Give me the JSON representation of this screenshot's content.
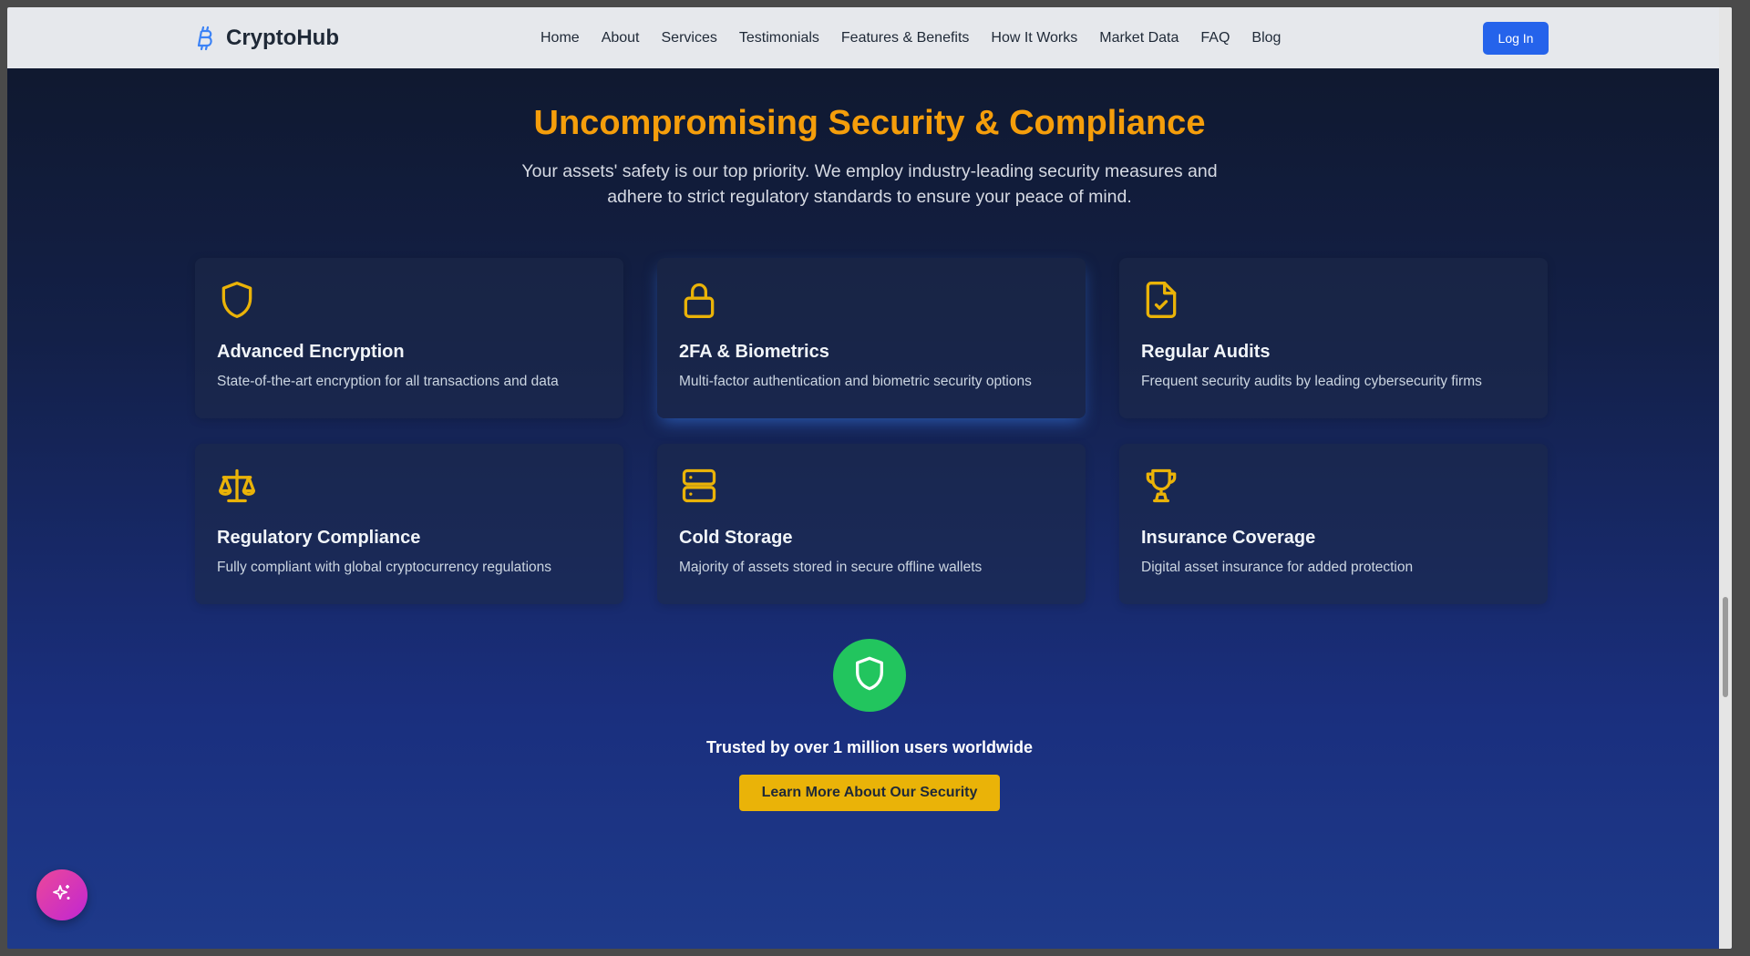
{
  "navbar": {
    "brand": "CryptoHub",
    "brand_icon": "bitcoin-icon",
    "links": [
      "Home",
      "About",
      "Services",
      "Testimonials",
      "Features & Benefits",
      "How It Works",
      "Market Data",
      "FAQ",
      "Blog"
    ],
    "login_label": "Log In"
  },
  "section": {
    "title": "Uncompromising Security & Compliance",
    "subtitle": "Your assets' safety is our top priority. We employ industry-leading security measures and adhere to strict regulatory standards to ensure your peace of mind."
  },
  "cards": [
    {
      "icon": "shield-icon",
      "title": "Advanced Encryption",
      "desc": "State-of-the-art encryption for all transactions and data"
    },
    {
      "icon": "lock-icon",
      "title": "2FA & Biometrics",
      "desc": "Multi-factor authentication and biometric security options"
    },
    {
      "icon": "file-check-icon",
      "title": "Regular Audits",
      "desc": "Frequent security audits by leading cybersecurity firms"
    },
    {
      "icon": "scale-icon",
      "title": "Regulatory Compliance",
      "desc": "Fully compliant with global cryptocurrency regulations"
    },
    {
      "icon": "server-icon",
      "title": "Cold Storage",
      "desc": "Majority of assets stored in secure offline wallets"
    },
    {
      "icon": "trophy-icon",
      "title": "Insurance Coverage",
      "desc": "Digital asset insurance for added protection"
    }
  ],
  "trust": {
    "icon": "shield-icon",
    "text": "Trusted by over 1 million users worldwide",
    "cta_label": "Learn More About Our Security"
  },
  "fab": {
    "icon": "sparkles-icon"
  },
  "colors": {
    "accent": "#f59e0b",
    "primary": "#2563eb",
    "success": "#22c55e",
    "cta": "#eab308"
  }
}
